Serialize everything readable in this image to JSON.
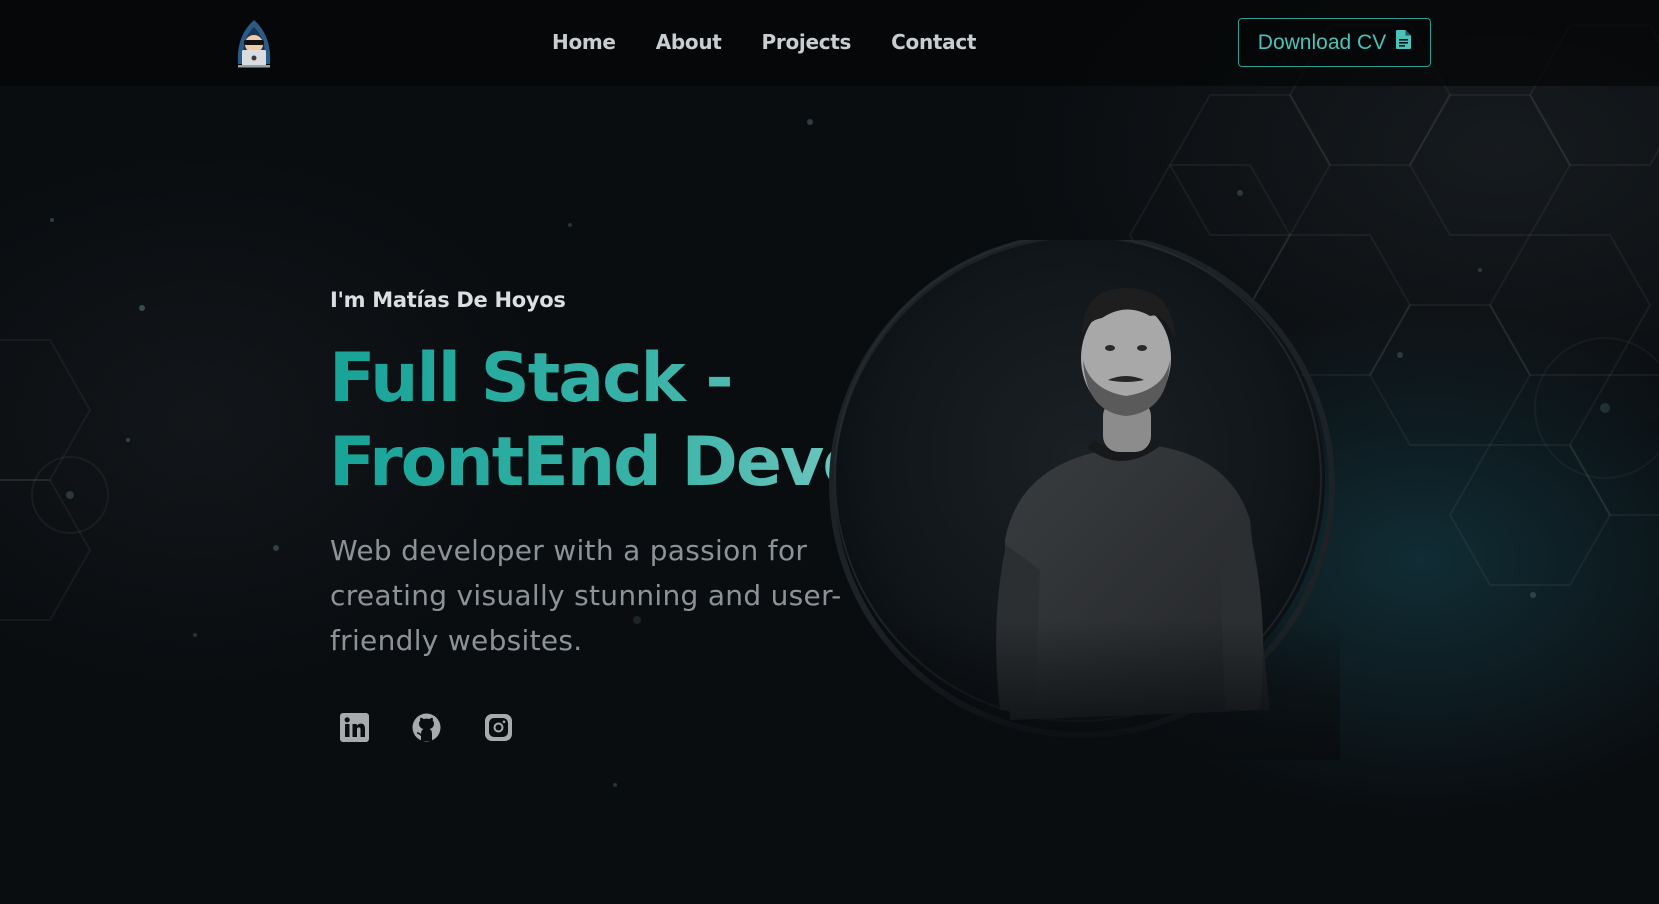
{
  "nav": {
    "logo_icon": "hooded-hacker-with-laptop-icon",
    "links": [
      {
        "label": "Home"
      },
      {
        "label": "About"
      },
      {
        "label": "Projects"
      },
      {
        "label": "Contact"
      }
    ],
    "cv_button": {
      "label": "Download CV",
      "icon": "file-document-icon"
    }
  },
  "hero": {
    "intro": "I'm Matías De Hoyos",
    "headline_line1": "Full Stack -",
    "headline_line2": "FrontEnd Developer",
    "description": "Web developer with a passion for creating visually stunning and user-friendly websites."
  },
  "socials": [
    {
      "icon": "linkedin-icon"
    },
    {
      "icon": "github-icon"
    },
    {
      "icon": "instagram-icon"
    }
  ],
  "colors": {
    "background": "#090c0e",
    "accent": "#2a9d96",
    "accent_light": "#a8dcd6",
    "nav_text": "#c9cdd0",
    "muted_text": "#8d9296"
  }
}
